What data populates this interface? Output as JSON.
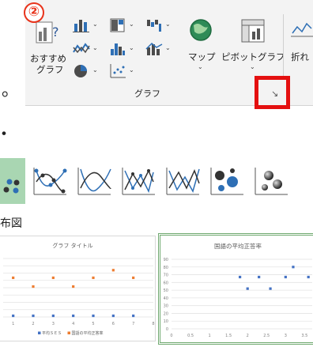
{
  "ribbon": {
    "badge": "②",
    "recommended_line1": "おすすめ",
    "recommended_line2": "グラフ",
    "map_label": "マップ",
    "pivot_label": "ピボットグラフ",
    "line_label": "折れ",
    "group_label": "グラフ",
    "chevron": "⌄",
    "launcher_glyph": "↘"
  },
  "bullets": [
    "。",
    "・"
  ],
  "gallery": {
    "items": [
      {
        "name": "scatter-markers-icon"
      },
      {
        "name": "scatter-smooth-lines-markers-icon"
      },
      {
        "name": "scatter-smooth-lines-icon"
      },
      {
        "name": "scatter-straight-lines-markers-icon"
      },
      {
        "name": "scatter-straight-lines-icon"
      },
      {
        "name": "bubble-icon"
      },
      {
        "name": "bubble-3d-icon"
      }
    ]
  },
  "heading": "布図",
  "chart_data": [
    {
      "type": "scatter",
      "title": "グラフ タイトル",
      "xlabel": "",
      "ylabel": "",
      "x_ticks": [
        "1",
        "2",
        "3",
        "4",
        "5",
        "6",
        "7",
        "8"
      ],
      "xlim": [
        0.5,
        8
      ],
      "ylim": [
        0,
        100
      ],
      "grid": true,
      "legend_position": "bottom",
      "series": [
        {
          "name": "平均ＳＥＳ",
          "color": "#4472c4",
          "x": [
            1,
            2,
            3,
            4,
            5,
            6,
            7
          ],
          "y": [
            2,
            2,
            2,
            2,
            2,
            2,
            2
          ]
        },
        {
          "name": "国語の平均正答率",
          "color": "#ed7d31",
          "x": [
            1,
            2,
            3,
            4,
            5,
            6,
            7
          ],
          "y": [
            67,
            52,
            67,
            52,
            67,
            80,
            67
          ]
        }
      ]
    },
    {
      "type": "scatter",
      "title": "国語の平均正答率",
      "xlabel": "",
      "ylabel": "",
      "x_ticks": [
        "0",
        "0.5",
        "1",
        "1.5",
        "2",
        "2.5",
        "3",
        "3.5"
      ],
      "y_ticks": [
        "0",
        "10",
        "20",
        "30",
        "40",
        "50",
        "60",
        "70",
        "80",
        "90"
      ],
      "xlim": [
        0,
        3.7
      ],
      "ylim": [
        0,
        90
      ],
      "grid": true,
      "series": [
        {
          "name": "",
          "color": "#4472c4",
          "x": [
            1.8,
            2.0,
            2.3,
            2.6,
            3.0,
            3.2,
            3.6
          ],
          "y": [
            67,
            52,
            67,
            52,
            67,
            80,
            67
          ]
        }
      ]
    }
  ]
}
